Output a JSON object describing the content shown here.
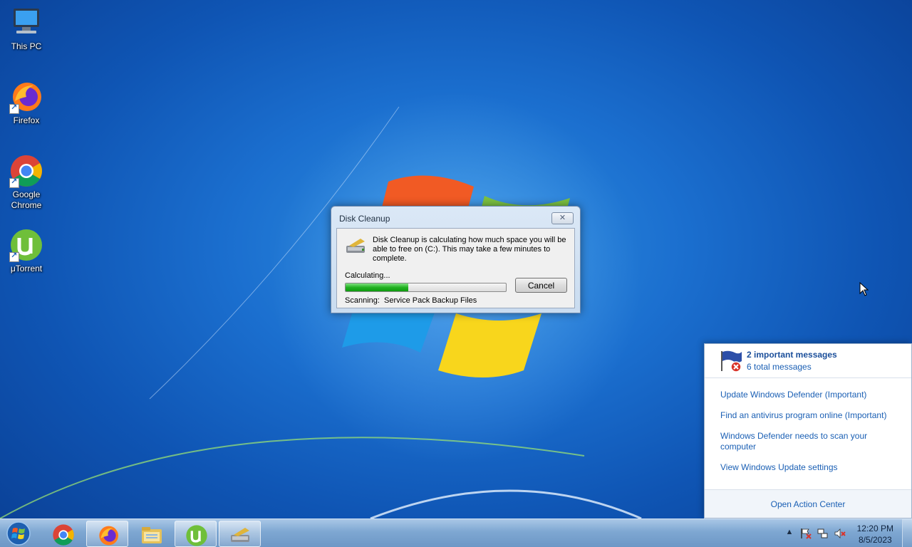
{
  "desktop": {
    "icons": [
      {
        "label": "This PC"
      },
      {
        "label": "Firefox"
      },
      {
        "label": "Google Chrome"
      },
      {
        "label": "μTorrent"
      }
    ]
  },
  "dialog": {
    "title": "Disk Cleanup",
    "close_label": "✕",
    "message": "Disk Cleanup is calculating how much space you will be able to free on  (C:). This may take a few minutes to complete.",
    "calculating_label": "Calculating...",
    "progress_fraction": 0.39,
    "cancel_label": "Cancel",
    "scanning_text": "Scanning:  Service Pack Backup Files"
  },
  "action_center": {
    "title": "2 important messages",
    "subtitle": "6 total messages",
    "links": [
      "Update Windows Defender (Important)",
      "Find an antivirus program online (Important)",
      "Windows Defender needs to scan your computer",
      "View Windows Update settings"
    ],
    "footer": "Open Action Center"
  },
  "taskbar": {
    "apps": [
      "start-icon",
      "chrome-icon",
      "firefox-icon",
      "file-explorer-icon",
      "utorrent-icon",
      "disk-cleanup-icon"
    ],
    "tray_expand": "▲",
    "clock_time": "12:20 PM",
    "clock_date": "8/5/2023"
  },
  "colors": {
    "accent": "#1a5fb4",
    "progress_green": "#23b223",
    "desktop_blue": "#1b6fcf"
  }
}
